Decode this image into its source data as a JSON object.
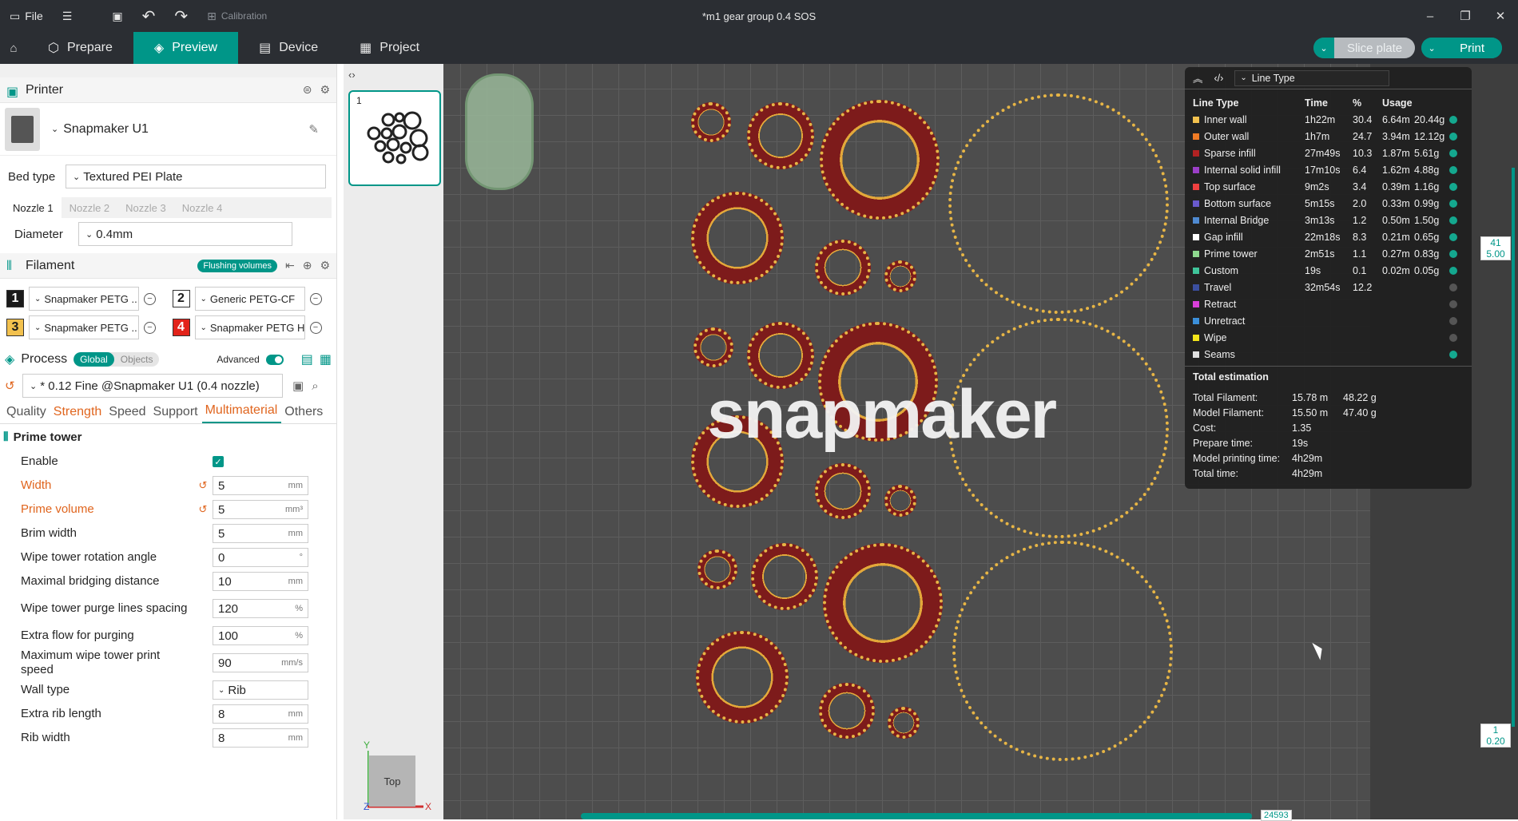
{
  "titlebar": {
    "file_label": "File",
    "calibration_label": "Calibration",
    "title": "*m1 gear group 0.4 SOS"
  },
  "nav": {
    "tabs": [
      {
        "label": "Prepare"
      },
      {
        "label": "Preview"
      },
      {
        "label": "Device"
      },
      {
        "label": "Project"
      }
    ],
    "slice_label": "Slice plate",
    "print_label": "Print"
  },
  "printer": {
    "section_label": "Printer",
    "name": "Snapmaker U1",
    "bed_type_label": "Bed type",
    "bed_type_value": "Textured PEI Plate",
    "nozzle_tabs": [
      "Nozzle 1",
      "Nozzle 2",
      "Nozzle 3",
      "Nozzle 4"
    ],
    "diameter_label": "Diameter",
    "diameter_value": "0.4mm"
  },
  "filament": {
    "section_label": "Filament",
    "flushing_label": "Flushing volumes",
    "items": [
      {
        "num": "1",
        "name": "Snapmaker PETG ...",
        "color": "#1a1a1a",
        "text": "#ffffff"
      },
      {
        "num": "2",
        "name": "Generic PETG-CF",
        "color": "#ffffff",
        "text": "#1a1a1a"
      },
      {
        "num": "3",
        "name": "Snapmaker PETG ...",
        "color": "#f2c14e",
        "text": "#1a1a1a"
      },
      {
        "num": "4",
        "name": "Snapmaker PETG HF",
        "color": "#e2231a",
        "text": "#ffffff"
      }
    ]
  },
  "process": {
    "section_label": "Process",
    "scope_global": "Global",
    "scope_objects": "Objects",
    "advanced_label": "Advanced",
    "profile": "* 0.12 Fine @Snapmaker U1 (0.4 nozzle)",
    "tabs": [
      "Quality",
      "Strength",
      "Speed",
      "Support",
      "Multimaterial",
      "Others"
    ],
    "group_title": "Prime tower",
    "params": [
      {
        "label": "Enable",
        "type": "check"
      },
      {
        "label": "Width",
        "value": "5",
        "unit": "mm",
        "modified": true
      },
      {
        "label": "Prime volume",
        "value": "5",
        "unit": "mm³",
        "modified": true
      },
      {
        "label": "Brim width",
        "value": "5",
        "unit": "mm"
      },
      {
        "label": "Wipe tower rotation angle",
        "value": "0",
        "unit": "°"
      },
      {
        "label": "Maximal bridging distance",
        "value": "10",
        "unit": "mm"
      },
      {
        "label": "Wipe tower purge lines spacing",
        "value": "120",
        "unit": "%"
      },
      {
        "label": "Extra flow for purging",
        "value": "100",
        "unit": "%"
      },
      {
        "label": "Maximum wipe tower print speed",
        "value": "90",
        "unit": "mm/s"
      },
      {
        "label": "Wall type",
        "value": "Rib",
        "unit": "",
        "select": true
      },
      {
        "label": "Extra rib length",
        "value": "8",
        "unit": "mm"
      },
      {
        "label": "Rib width",
        "value": "8",
        "unit": "mm"
      }
    ]
  },
  "plates": {
    "items": [
      {
        "num": "1"
      }
    ]
  },
  "canvas": {
    "logo_text": "snapmaker",
    "view_label": "Top",
    "axis_x": "X",
    "axis_y": "Y",
    "axis_z": "Z",
    "layer_top_num": "41",
    "layer_top_height": "5.00",
    "layer_bottom_num": "1",
    "layer_bottom_height": "0.20",
    "move_label": "24593"
  },
  "legend": {
    "dropdown": "Line Type",
    "headers": [
      "Line Type",
      "Time",
      "%",
      "Usage"
    ],
    "rows": [
      {
        "name": "Inner wall",
        "time": "1h22m",
        "pct": "30.4",
        "len": "6.64m",
        "wt": "20.44g",
        "color": "#f2c14e",
        "visible": true
      },
      {
        "name": "Outer wall",
        "time": "1h7m",
        "pct": "24.7",
        "len": "3.94m",
        "wt": "12.12g",
        "color": "#f07b25",
        "visible": true
      },
      {
        "name": "Sparse infill",
        "time": "27m49s",
        "pct": "10.3",
        "len": "1.87m",
        "wt": "5.61g",
        "color": "#b22222",
        "visible": true
      },
      {
        "name": "Internal solid infill",
        "time": "17m10s",
        "pct": "6.4",
        "len": "1.62m",
        "wt": "4.88g",
        "color": "#9b3fc8",
        "visible": true
      },
      {
        "name": "Top surface",
        "time": "9m2s",
        "pct": "3.4",
        "len": "0.39m",
        "wt": "1.16g",
        "color": "#f04040",
        "visible": true
      },
      {
        "name": "Bottom surface",
        "time": "5m15s",
        "pct": "2.0",
        "len": "0.33m",
        "wt": "0.99g",
        "color": "#6a5acd",
        "visible": true
      },
      {
        "name": "Internal Bridge",
        "time": "3m13s",
        "pct": "1.2",
        "len": "0.50m",
        "wt": "1.50g",
        "color": "#4f8ad1",
        "visible": true
      },
      {
        "name": "Gap infill",
        "time": "22m18s",
        "pct": "8.3",
        "len": "0.21m",
        "wt": "0.65g",
        "color": "#ffffff",
        "visible": true
      },
      {
        "name": "Prime tower",
        "time": "2m51s",
        "pct": "1.1",
        "len": "0.27m",
        "wt": "0.83g",
        "color": "#8fd98f",
        "visible": true
      },
      {
        "name": "Custom",
        "time": "19s",
        "pct": "0.1",
        "len": "0.02m",
        "wt": "0.05g",
        "color": "#3fc49a",
        "visible": true
      },
      {
        "name": "Travel",
        "time": "32m54s",
        "pct": "12.2",
        "len": "",
        "wt": "",
        "color": "#3b4fa0",
        "visible": false
      },
      {
        "name": "Retract",
        "time": "",
        "pct": "",
        "len": "",
        "wt": "",
        "color": "#d93fd9",
        "visible": false
      },
      {
        "name": "Unretract",
        "time": "",
        "pct": "",
        "len": "",
        "wt": "",
        "color": "#3b8fd9",
        "visible": false
      },
      {
        "name": "Wipe",
        "time": "",
        "pct": "",
        "len": "",
        "wt": "",
        "color": "#f2e41a",
        "visible": false
      },
      {
        "name": "Seams",
        "time": "",
        "pct": "",
        "len": "",
        "wt": "",
        "color": "#e0e0e0",
        "visible": true
      }
    ],
    "total_title": "Total estimation",
    "totals": [
      {
        "k": "Total Filament:",
        "v1": "15.78 m",
        "v2": "48.22 g"
      },
      {
        "k": "Model Filament:",
        "v1": "15.50 m",
        "v2": "47.40 g"
      },
      {
        "k": "Cost:",
        "v1": "1.35",
        "v2": ""
      },
      {
        "k": "Prepare time:",
        "v1": "19s",
        "v2": ""
      },
      {
        "k": "Model printing time:",
        "v1": "4h29m",
        "v2": ""
      },
      {
        "k": "Total time:",
        "v1": "4h29m",
        "v2": ""
      }
    ]
  }
}
